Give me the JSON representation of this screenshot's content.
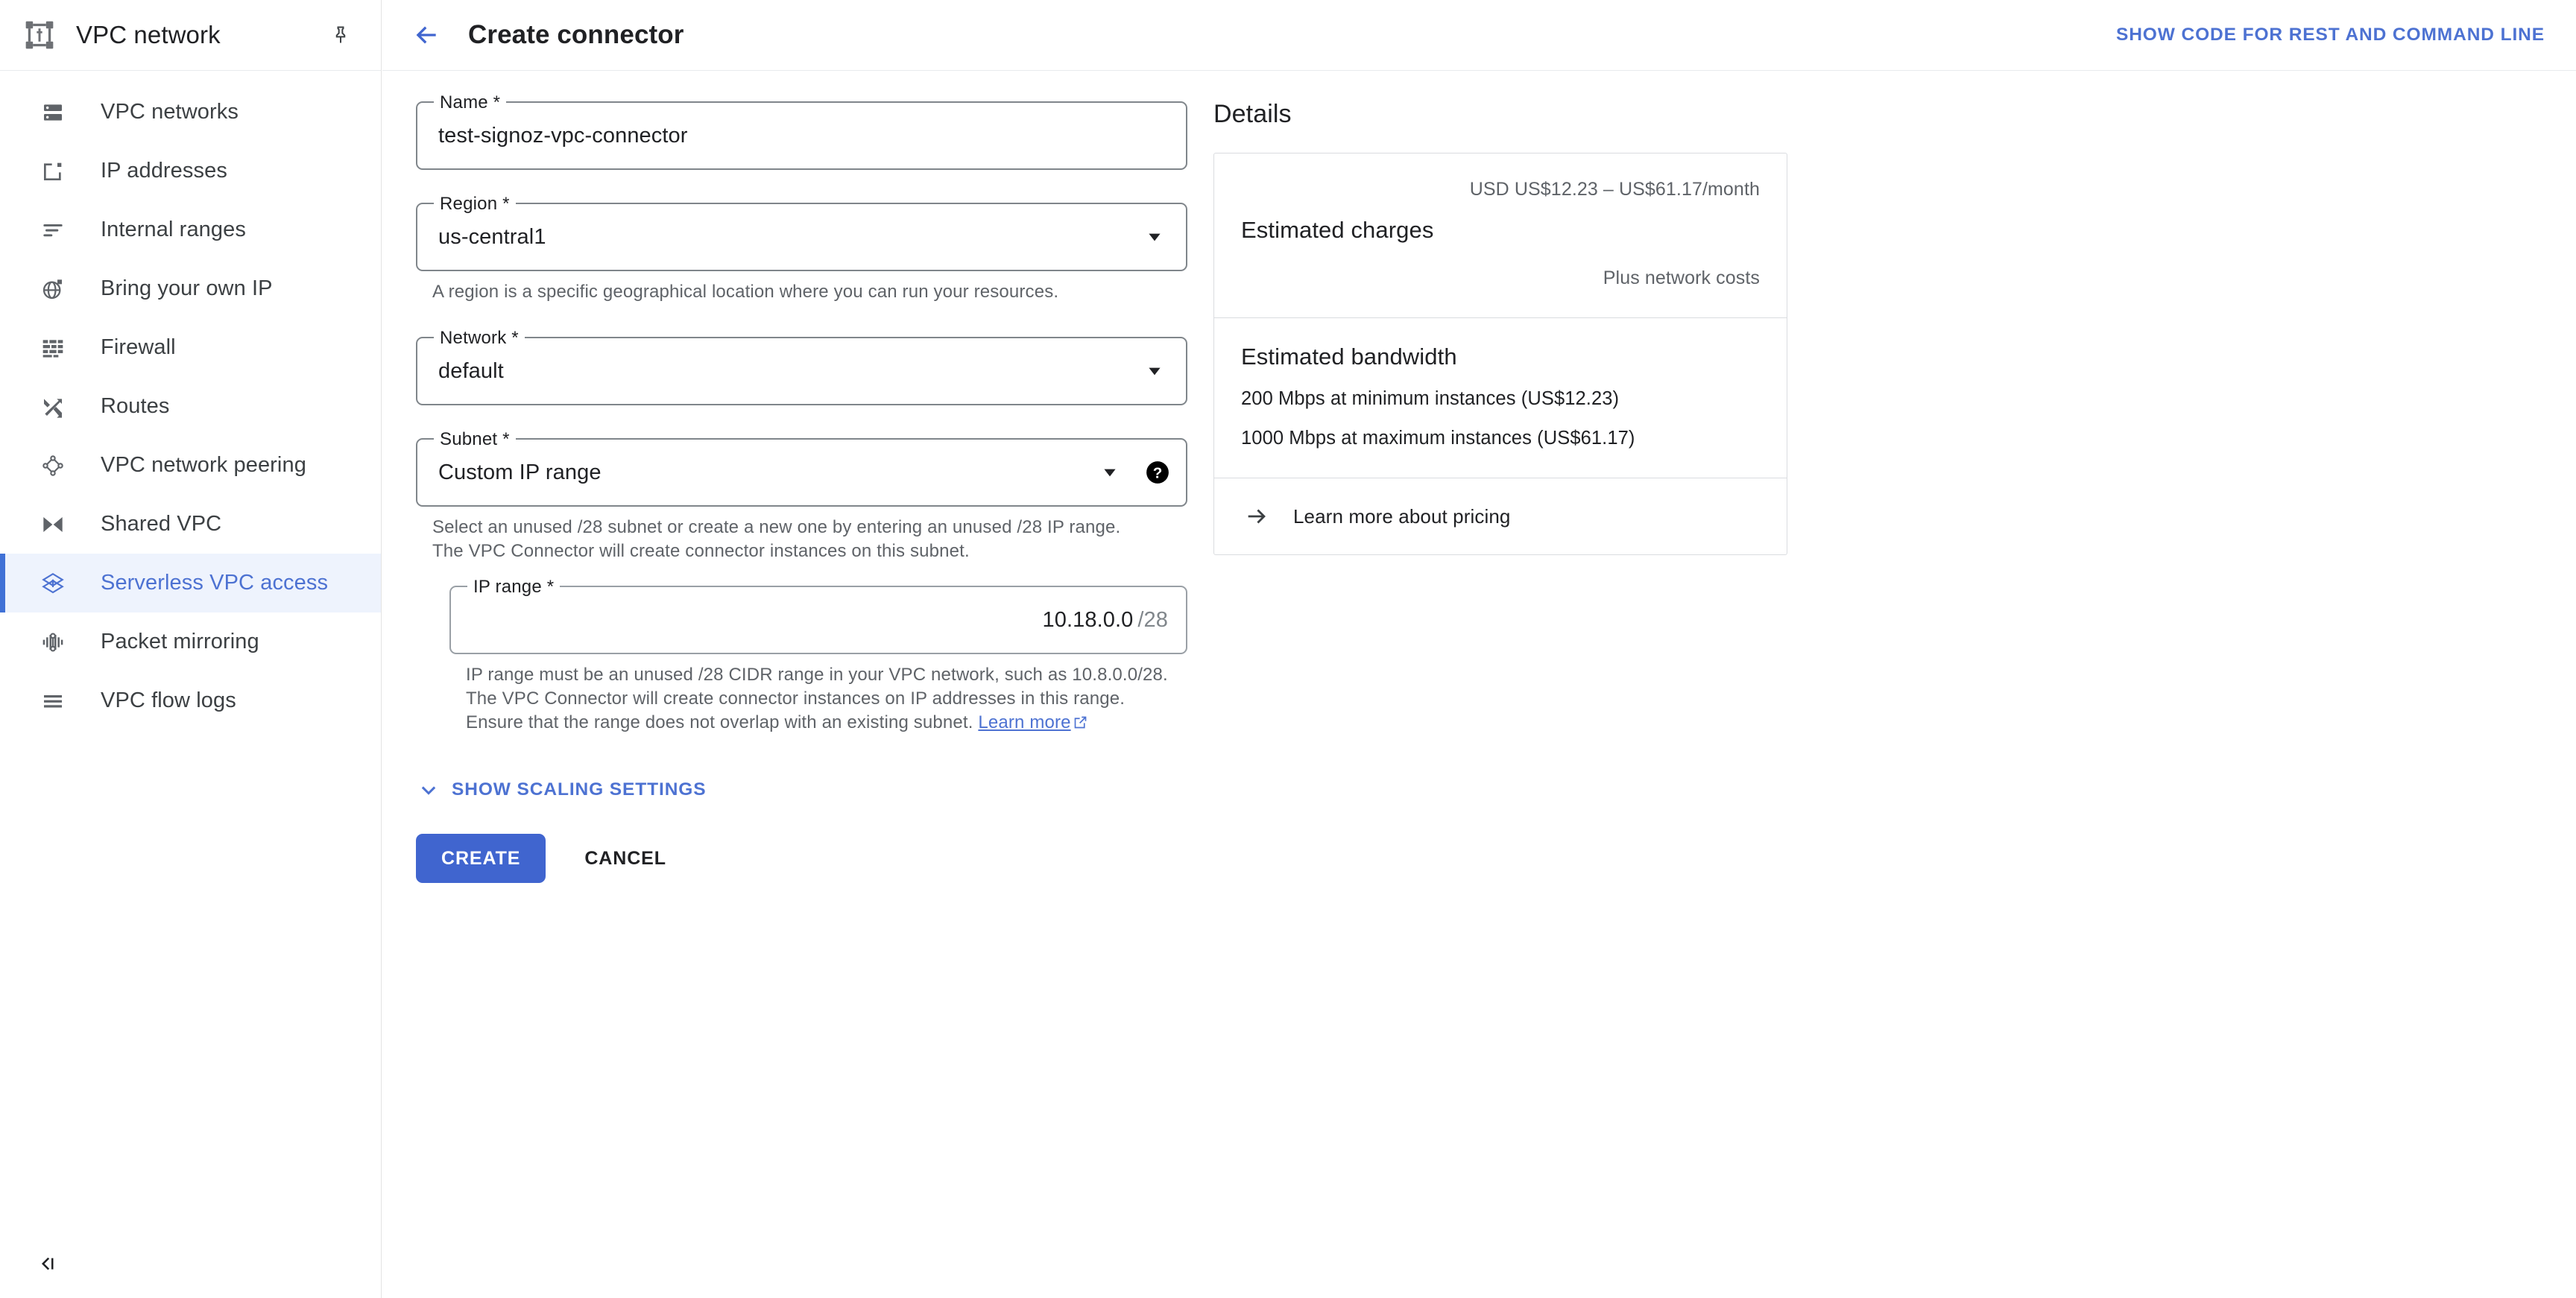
{
  "sidebar": {
    "product_title": "VPC network",
    "product_icon": "vpc-network-icon",
    "pin_icon": "pin-icon",
    "collapse_icon": "collapse-panel-icon",
    "items": [
      {
        "label": "VPC networks",
        "icon": "vpc-networks-icon",
        "active": false
      },
      {
        "label": "IP addresses",
        "icon": "ip-addresses-icon",
        "active": false
      },
      {
        "label": "Internal ranges",
        "icon": "internal-ranges-icon",
        "active": false
      },
      {
        "label": "Bring your own IP",
        "icon": "bring-your-own-ip-icon",
        "active": false
      },
      {
        "label": "Firewall",
        "icon": "firewall-icon",
        "active": false
      },
      {
        "label": "Routes",
        "icon": "routes-icon",
        "active": false
      },
      {
        "label": "VPC network peering",
        "icon": "vpc-peering-icon",
        "active": false
      },
      {
        "label": "Shared VPC",
        "icon": "shared-vpc-icon",
        "active": false
      },
      {
        "label": "Serverless VPC access",
        "icon": "serverless-vpc-icon",
        "active": true
      },
      {
        "label": "Packet mirroring",
        "icon": "packet-mirroring-icon",
        "active": false
      },
      {
        "label": "VPC flow logs",
        "icon": "vpc-flow-logs-icon",
        "active": false
      }
    ]
  },
  "topbar": {
    "back_icon": "back-arrow-icon",
    "title": "Create connector",
    "rest_link": "SHOW CODE FOR REST AND COMMAND LINE"
  },
  "form": {
    "name": {
      "label": "Name *",
      "value": "test-signoz-vpc-connector",
      "placeholder": ""
    },
    "region": {
      "label": "Region *",
      "value": "us-central1",
      "hint": "A region is a specific geographical location where you can run your resources."
    },
    "network": {
      "label": "Network *",
      "value": "default"
    },
    "subnet": {
      "label": "Subnet *",
      "value": "Custom IP range",
      "help_icon": "help-circle-icon",
      "hint": "Select an unused /28 subnet or create a new one by entering an unused /28 IP range. The VPC Connector will create connector instances on this subnet."
    },
    "ip_range": {
      "label": "IP range *",
      "value": "10.18.0.0",
      "suffix": "/28",
      "hint_before_link": "IP range must be an unused /28 CIDR range in your VPC network, such as 10.8.0.0/28. The VPC Connector will create connector instances on IP addresses in this range. Ensure that the range does not overlap with an existing subnet. ",
      "hint_link": "Learn more",
      "link_icon": "external-link-icon"
    },
    "scaling_toggle": {
      "label": "SHOW SCALING SETTINGS",
      "icon": "chevron-down-icon"
    },
    "create_button": "CREATE",
    "cancel_button": "CANCEL"
  },
  "details": {
    "title": "Details",
    "charges": {
      "range": "USD US$12.23 – US$61.17/month",
      "heading": "Estimated charges",
      "note": "Plus network costs"
    },
    "bandwidth": {
      "heading": "Estimated bandwidth",
      "lines": [
        "200 Mbps at minimum instances (US$12.23)",
        "1000 Mbps at maximum instances (US$61.17)"
      ]
    },
    "pricing_link": {
      "label": "Learn more about pricing",
      "icon": "arrow-right-icon"
    }
  },
  "colors": {
    "accent_blue": "#4d72d2",
    "primary_button": "#4065cf",
    "active_nav_bg": "#eef3fd",
    "text_primary": "#202124",
    "text_secondary": "#5f6368",
    "field_border": "#80868b",
    "card_border": "#dadce0"
  }
}
